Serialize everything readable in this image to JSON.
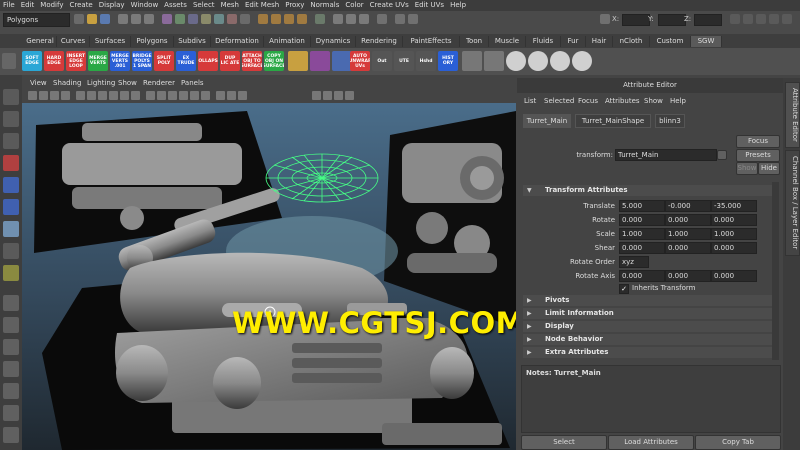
{
  "menubar": [
    "File",
    "Edit",
    "Modify",
    "Create",
    "Display",
    "Window",
    "Assets",
    "Select",
    "Mesh",
    "Edit Mesh",
    "Proxy",
    "Normals",
    "Color",
    "Create UVs",
    "Edit UVs",
    "Help"
  ],
  "statusline": {
    "mode": "Polygons",
    "x_label": "X:",
    "y_label": "Y:",
    "z_label": "Z:"
  },
  "shelf_tabs": [
    "General",
    "Curves",
    "Surfaces",
    "Polygons",
    "Subdivs",
    "Deformation",
    "Animation",
    "Dynamics",
    "Rendering",
    "PaintEffects",
    "Toon",
    "Muscle",
    "Fluids",
    "Fur",
    "Hair",
    "nCloth",
    "Custom",
    "SGW"
  ],
  "shelf_buttons": [
    {
      "label": "SOFT EDGE",
      "color": "#2aa7d6"
    },
    {
      "label": "HARD EDGE",
      "color": "#d63a3a"
    },
    {
      "label": "INSERT EDGE LOOP",
      "color": "#d63a3a"
    },
    {
      "label": "MERGE VERTS",
      "color": "#2aa845"
    },
    {
      "label": "MERGE VERTS .001",
      "color": "#2a5fd6"
    },
    {
      "label": "BRIDGE POLYS 1 SPAN",
      "color": "#2a5fd6"
    },
    {
      "label": "SPLIT POLY",
      "color": "#d63a3a"
    },
    {
      "label": "EX TRUDE",
      "color": "#2a5fd6"
    },
    {
      "label": "COLLAPSE",
      "color": "#d63a3a"
    },
    {
      "label": "DUP LIC ATE",
      "color": "#d63a3a"
    },
    {
      "label": "ATTACH OBJ TO SURFACE",
      "color": "#d63a3a"
    },
    {
      "label": "COPY OBJ ON SURFACE",
      "color": "#2aa845"
    },
    {
      "label": "AUTO UNWRAP UVs",
      "color": "#d63a3a"
    },
    {
      "label": "Out",
      "color": "#555555"
    },
    {
      "label": "UTE",
      "color": "#555555"
    },
    {
      "label": "Hshd",
      "color": "#555555"
    },
    {
      "label": "HIST ORY",
      "color": "#2a5fd6"
    }
  ],
  "viewport_menu": [
    "View",
    "Shading",
    "Lighting",
    "Show",
    "Renderer",
    "Panels"
  ],
  "watermark": "WWW.CGTSJ.COM",
  "attribute_editor": {
    "title": "Attribute Editor",
    "menu": [
      "List",
      "Selected",
      "Focus",
      "Attributes",
      "Show",
      "Help"
    ],
    "tabs": [
      "Turret_Main",
      "Turret_MainShape",
      "blinn3"
    ],
    "transform_label": "transform:",
    "transform_value": "Turret_Main",
    "focus": "Focus",
    "presets": "Presets",
    "show": "Show",
    "hide": "Hide",
    "section_transform": "Transform Attributes",
    "translate_label": "Translate",
    "translate": [
      "5.000",
      "-0.000",
      "-35.000"
    ],
    "rotate_label": "Rotate",
    "rotate": [
      "0.000",
      "0.000",
      "0.000"
    ],
    "scale_label": "Scale",
    "scale": [
      "1.000",
      "1.000",
      "1.000"
    ],
    "shear_label": "Shear",
    "shear": [
      "0.000",
      "0.000",
      "0.000"
    ],
    "rotate_order_label": "Rotate Order",
    "rotate_order": "xyz",
    "rotate_axis_label": "Rotate Axis",
    "rotate_axis": [
      "0.000",
      "0.000",
      "0.000"
    ],
    "inherits_transform": "Inherits Transform",
    "sections": [
      "Pivots",
      "Limit Information",
      "Display",
      "Node Behavior",
      "Extra Attributes"
    ],
    "notes": "Notes: Turret_Main",
    "select": "Select",
    "load_attributes": "Load Attributes",
    "copy_tab": "Copy Tab"
  },
  "right_tabs": [
    "Attribute Editor",
    "Channel Box / Layer Editor"
  ]
}
